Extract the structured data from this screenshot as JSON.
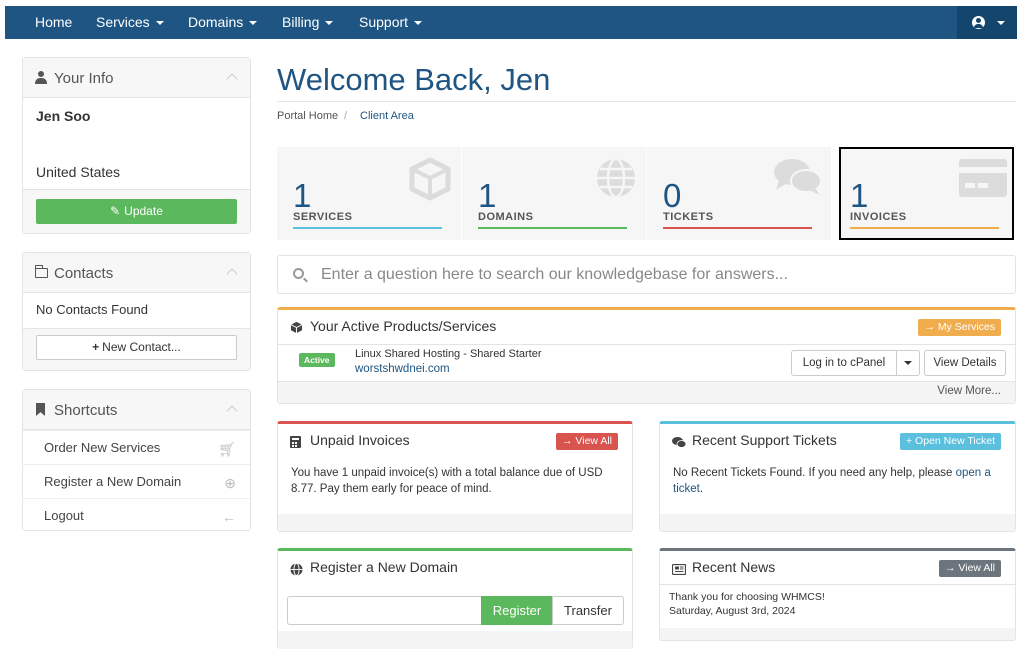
{
  "nav": {
    "items": [
      {
        "label": "Home",
        "has_caret": false
      },
      {
        "label": "Services",
        "has_caret": true
      },
      {
        "label": "Domains",
        "has_caret": true
      },
      {
        "label": "Billing",
        "has_caret": true
      },
      {
        "label": "Support",
        "has_caret": true
      }
    ],
    "user_icon": "user-circle-icon"
  },
  "sidebar": {
    "your_info": {
      "title": "Your Info",
      "name": "Jen Soo",
      "country": "United States",
      "update_label": "Update"
    },
    "contacts": {
      "title": "Contacts",
      "empty_text": "No Contacts Found",
      "new_contact_label": "New Contact..."
    },
    "shortcuts": {
      "title": "Shortcuts",
      "items": [
        {
          "label": "Order New Services",
          "icon": "cart-icon"
        },
        {
          "label": "Register a New Domain",
          "icon": "globe-icon"
        },
        {
          "label": "Logout",
          "icon": "arrow-left-icon"
        }
      ]
    }
  },
  "main": {
    "title": "Welcome Back, Jen",
    "breadcrumb": {
      "home": "Portal Home",
      "separator": "/",
      "current": "Client Area"
    },
    "stats": [
      {
        "number": "1",
        "label": "SERVICES",
        "color": "#5bc0de",
        "icon": "cube-icon"
      },
      {
        "number": "1",
        "label": "DOMAINS",
        "color": "#5cb85c",
        "icon": "globe-icon"
      },
      {
        "number": "0",
        "label": "TICKETS",
        "color": "#d9534f",
        "icon": "comments-icon"
      },
      {
        "number": "1",
        "label": "INVOICES",
        "color": "#f0ad4e",
        "icon": "credit-card-icon"
      }
    ],
    "search": {
      "placeholder": "Enter a question here to search our knowledgebase for answers..."
    },
    "products": {
      "title": "Your Active Products/Services",
      "my_services_label": "My Services",
      "status": "Active",
      "product_name": "Linux Shared Hosting - Shared Starter",
      "product_domain": "worstshwdnei.com",
      "login_label": "Log in to cPanel",
      "details_label": "View Details",
      "view_more": "View More..."
    },
    "invoices": {
      "title": "Unpaid Invoices",
      "view_all": "View All",
      "text": "You have 1 unpaid invoice(s) with a total balance due of USD 8.77. Pay them early for peace of mind."
    },
    "tickets": {
      "title": "Recent Support Tickets",
      "open_new": "Open New Ticket",
      "text": "No Recent Tickets Found. If you need any help, please",
      "link": "open a ticket",
      "after": "."
    },
    "domain": {
      "title": "Register a New Domain",
      "register_label": "Register",
      "transfer_label": "Transfer"
    },
    "news": {
      "title": "Recent News",
      "view_all": "View All",
      "headline": "Thank you for choosing WHMCS!",
      "date": "Saturday, August 3rd, 2024"
    }
  },
  "colors": {
    "navbar": "#1e5582",
    "accent_blue": "#1e5582",
    "green": "#5cb85c",
    "red": "#d9534f",
    "orange": "#f0ad4e",
    "cyan": "#5bc0de",
    "gray": "#6c757d"
  }
}
